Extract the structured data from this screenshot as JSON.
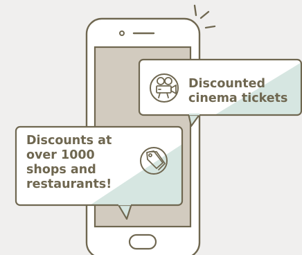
{
  "colors": {
    "background": "#f0efee",
    "outline": "#6f6750",
    "phone_body": "#ffffff",
    "screen": "#d2cbbf",
    "bubble_fill": "#ffffff",
    "bubble_accent": "#d6e6e1",
    "text": "#6f6750"
  },
  "icons": {
    "notification": "notification-sparkle-icon",
    "cinema": "movie-camera-icon",
    "shopping": "price-tag-icon"
  },
  "bubbles": {
    "cinema": {
      "lines": [
        "Discounted",
        "cinema tickets"
      ]
    },
    "shops": {
      "lines": [
        "Discounts at",
        "over 1000",
        "shops and",
        "restaurants!"
      ]
    }
  }
}
